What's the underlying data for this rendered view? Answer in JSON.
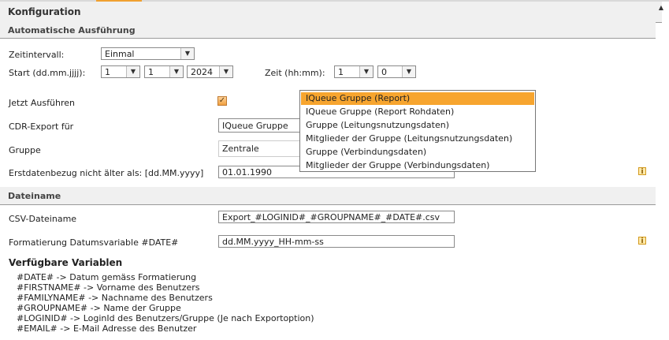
{
  "header": {
    "title": "Konfiguration",
    "scroll_up": "▲"
  },
  "auto": {
    "section_title": "Automatische Ausführung",
    "interval_label": "Zeitintervall:",
    "interval_value": "Einmal",
    "start_label": "Start (dd.mm.jjjj):",
    "start_day": "1",
    "start_month": "1",
    "start_year": "2024",
    "time_label": "Zeit (hh:mm):",
    "time_hour": "1",
    "time_minute": "0",
    "run_now_label": "Jetzt Ausführen",
    "run_now_checked": true,
    "cdr_label": "CDR-Export für",
    "cdr_value": "IQueue Gruppe",
    "group_label": "Gruppe",
    "group_value": "Zentrale",
    "first_date_label": "Erstdatenbezug nicht älter als: [dd.MM.yyyy]",
    "first_date_value": "01.01.1990",
    "dropdown_options": [
      "IQueue Gruppe (Report)",
      "IQueue Gruppe (Report Rohdaten)",
      "Gruppe (Leitungsnutzungsdaten)",
      "Mitglieder der Gruppe (Leitungsnutzungsdaten)",
      "Gruppe (Verbindungsdaten)",
      "Mitglieder der Gruppe (Verbindungsdaten)"
    ],
    "dropdown_selected_index": 0
  },
  "file": {
    "section_title": "Dateiname",
    "csv_label": "CSV-Dateiname",
    "csv_value": "Export_#LOGINID#_#GROUPNAME#_#DATE#.csv",
    "format_label": "Formatierung Datumsvariable #DATE#",
    "format_value": "dd.MM.yyyy_HH-mm-ss",
    "vars_title": "Verfügbare Variablen",
    "vars": [
      "#DATE# -> Datum gemäss Formatierung",
      "#FIRSTNAME# -> Vorname des Benutzers",
      "#FAMILYNAME# -> Nachname des Benutzers",
      "#GROUPNAME# -> Name der Gruppe",
      "#LOGINID# -> LoginId des Benutzers/Gruppe (Je nach Exportoption)",
      "#EMAIL# -> E-Mail Adresse des Benutzer"
    ]
  },
  "icons": {
    "info": "i",
    "dropdown_arrow": "▼",
    "checkmark": "✓"
  },
  "colors": {
    "accent": "#f7a52f",
    "header_bg": "#f0f0f0",
    "info_border": "#d39b20"
  }
}
